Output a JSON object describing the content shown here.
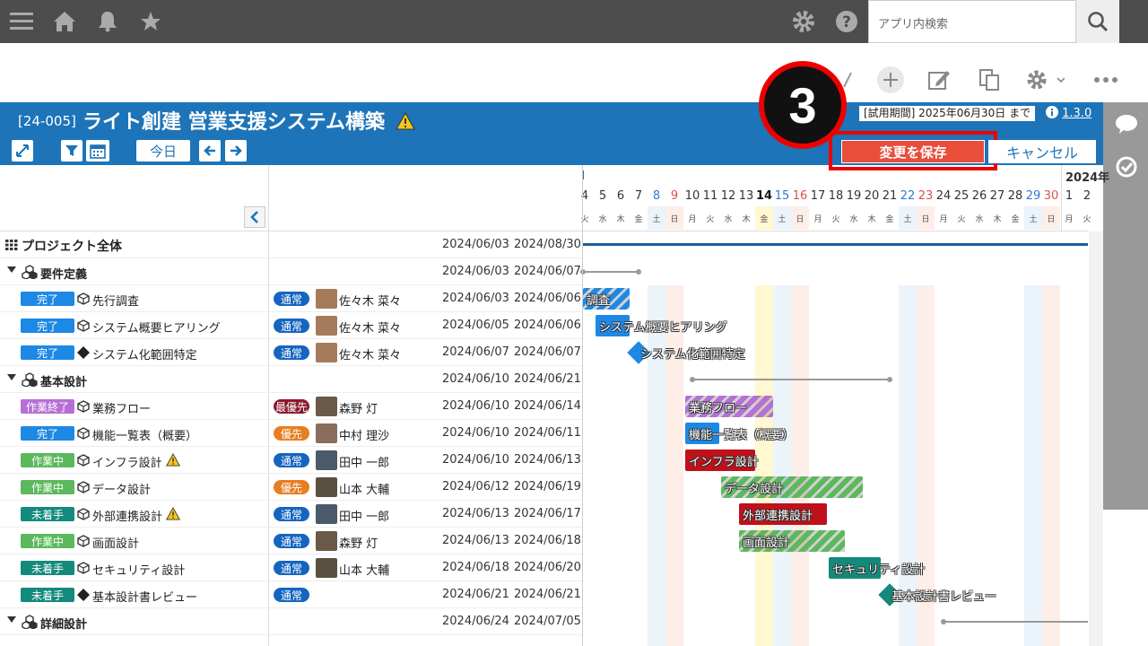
{
  "search": {
    "placeholder": "アプリ内検索"
  },
  "header": {
    "project_code": "[24-005]",
    "project_title": "ライト創建 営業支援システム構築",
    "trial_label": "[試用期間] 2025年06月30日 まで",
    "version": "1.3.0",
    "today_button": "今日",
    "save_button": "変更を保存",
    "cancel_button": "キャンセル",
    "step_number": "3"
  },
  "calendar": {
    "year_label": "2024年",
    "days": [
      {
        "num": "4",
        "wk": "火",
        "type": "normal"
      },
      {
        "num": "5",
        "wk": "水",
        "type": "normal"
      },
      {
        "num": "6",
        "wk": "木",
        "type": "normal"
      },
      {
        "num": "7",
        "wk": "金",
        "type": "normal"
      },
      {
        "num": "8",
        "wk": "土",
        "type": "sat"
      },
      {
        "num": "9",
        "wk": "日",
        "type": "sun"
      },
      {
        "num": "10",
        "wk": "月",
        "type": "normal"
      },
      {
        "num": "11",
        "wk": "火",
        "type": "normal"
      },
      {
        "num": "12",
        "wk": "水",
        "type": "normal"
      },
      {
        "num": "13",
        "wk": "木",
        "type": "normal"
      },
      {
        "num": "14",
        "wk": "金",
        "type": "today"
      },
      {
        "num": "15",
        "wk": "土",
        "type": "sat"
      },
      {
        "num": "16",
        "wk": "日",
        "type": "sun"
      },
      {
        "num": "17",
        "wk": "月",
        "type": "normal"
      },
      {
        "num": "18",
        "wk": "火",
        "type": "normal"
      },
      {
        "num": "19",
        "wk": "水",
        "type": "normal"
      },
      {
        "num": "20",
        "wk": "木",
        "type": "normal"
      },
      {
        "num": "21",
        "wk": "金",
        "type": "normal"
      },
      {
        "num": "22",
        "wk": "土",
        "type": "sat"
      },
      {
        "num": "23",
        "wk": "日",
        "type": "sun"
      },
      {
        "num": "24",
        "wk": "月",
        "type": "normal"
      },
      {
        "num": "25",
        "wk": "火",
        "type": "normal"
      },
      {
        "num": "26",
        "wk": "水",
        "type": "normal"
      },
      {
        "num": "27",
        "wk": "木",
        "type": "normal"
      },
      {
        "num": "28",
        "wk": "金",
        "type": "normal"
      },
      {
        "num": "29",
        "wk": "土",
        "type": "sat"
      },
      {
        "num": "30",
        "wk": "日",
        "type": "sun"
      },
      {
        "num": "1",
        "wk": "月",
        "type": "normal"
      },
      {
        "num": "2",
        "wk": "火",
        "type": "normal"
      }
    ]
  },
  "rows": [
    {
      "kind": "project",
      "name": "プロジェクト全体",
      "start": "2024/06/03",
      "end": "2024/08/30"
    },
    {
      "kind": "group",
      "name": "要件定義",
      "start": "2024/06/03",
      "end": "2024/06/07"
    },
    {
      "kind": "task",
      "status": "完了",
      "status_color": "#1e88e5",
      "icon": "cube",
      "name": "先行調査",
      "warn": false,
      "priority": "通常",
      "prio_color": "#1565c0",
      "person": "佐々木 菜々",
      "start": "2024/06/03",
      "end": "2024/06/06"
    },
    {
      "kind": "task",
      "status": "完了",
      "status_color": "#1e88e5",
      "icon": "cube",
      "name": "システム概要ヒアリング",
      "warn": false,
      "priority": "通常",
      "prio_color": "#1565c0",
      "person": "佐々木 菜々",
      "start": "2024/06/05",
      "end": "2024/06/06"
    },
    {
      "kind": "task",
      "status": "完了",
      "status_color": "#1e88e5",
      "icon": "diamond",
      "name": "システム化範囲特定",
      "warn": false,
      "priority": "通常",
      "prio_color": "#1565c0",
      "person": "佐々木 菜々",
      "start": "2024/06/07",
      "end": "2024/06/07"
    },
    {
      "kind": "group",
      "name": "基本設計",
      "start": "2024/06/10",
      "end": "2024/06/21"
    },
    {
      "kind": "task",
      "status": "作業終了",
      "status_color": "#b56fd6",
      "icon": "cube",
      "name": "業務フロー",
      "warn": false,
      "priority": "最優先",
      "prio_color": "#8b1a2e",
      "person": "森野 灯",
      "start": "2024/06/10",
      "end": "2024/06/14"
    },
    {
      "kind": "task",
      "status": "完了",
      "status_color": "#1e88e5",
      "icon": "cube",
      "name": "機能一覧表（概要）",
      "warn": false,
      "priority": "優先",
      "prio_color": "#e67e22",
      "person": "中村 理沙",
      "start": "2024/06/10",
      "end": "2024/06/11"
    },
    {
      "kind": "task",
      "status": "作業中",
      "status_color": "#5cb85c",
      "icon": "cube",
      "name": "インフラ設計",
      "warn": true,
      "priority": "通常",
      "prio_color": "#1565c0",
      "person": "田中 一郎",
      "start": "2024/06/10",
      "end": "2024/06/13"
    },
    {
      "kind": "task",
      "status": "作業中",
      "status_color": "#5cb85c",
      "icon": "cube",
      "name": "データ設計",
      "warn": false,
      "priority": "優先",
      "prio_color": "#e67e22",
      "person": "山本 大輔",
      "start": "2024/06/12",
      "end": "2024/06/19"
    },
    {
      "kind": "task",
      "status": "未着手",
      "status_color": "#138a7c",
      "icon": "cube",
      "name": "外部連携設計",
      "warn": true,
      "priority": "通常",
      "prio_color": "#1565c0",
      "person": "田中 一郎",
      "start": "2024/06/13",
      "end": "2024/06/17"
    },
    {
      "kind": "task",
      "status": "作業中",
      "status_color": "#5cb85c",
      "icon": "cube",
      "name": "画面設計",
      "warn": false,
      "priority": "通常",
      "prio_color": "#1565c0",
      "person": "森野 灯",
      "start": "2024/06/13",
      "end": "2024/06/18"
    },
    {
      "kind": "task",
      "status": "未着手",
      "status_color": "#138a7c",
      "icon": "cube",
      "name": "セキュリティ設計",
      "warn": false,
      "priority": "通常",
      "prio_color": "#1565c0",
      "person": "山本 大輔",
      "start": "2024/06/18",
      "end": "2024/06/20"
    },
    {
      "kind": "task",
      "status": "未着手",
      "status_color": "#138a7c",
      "icon": "diamond",
      "name": "基本設計書レビュー",
      "warn": false,
      "priority": "通常",
      "prio_color": "#1565c0",
      "person": "",
      "start": "2024/06/21",
      "end": "2024/06/21"
    },
    {
      "kind": "group",
      "name": "詳細設計",
      "start": "2024/06/24",
      "end": "2024/07/05"
    }
  ],
  "bars": [
    {
      "label": "調査",
      "color": "#1e88e5",
      "striped": true
    },
    {
      "label": "システム概要ヒアリング",
      "color": "#1e88e5",
      "striped": false
    },
    {
      "label": "システム化範囲特定",
      "color": "#1e88e5",
      "milestone": true
    },
    {
      "label": "業務フロー",
      "color": "#b56fd6",
      "striped": true
    },
    {
      "label": "機能一覧表（概要）",
      "color": "#1e88e5",
      "striped": false
    },
    {
      "label": "インフラ設計",
      "color": "#c0101a",
      "striped": false
    },
    {
      "label": "データ設計",
      "color": "#5cb85c",
      "striped": true
    },
    {
      "label": "外部連携設計",
      "color": "#c0101a",
      "striped": false
    },
    {
      "label": "画面設計",
      "color": "#5cb85c",
      "striped": true
    },
    {
      "label": "セキュリティ設計",
      "color": "#138a7c",
      "striped": false
    },
    {
      "label": "基本設計書レビュー",
      "color": "#138a7c",
      "milestone": true
    }
  ]
}
